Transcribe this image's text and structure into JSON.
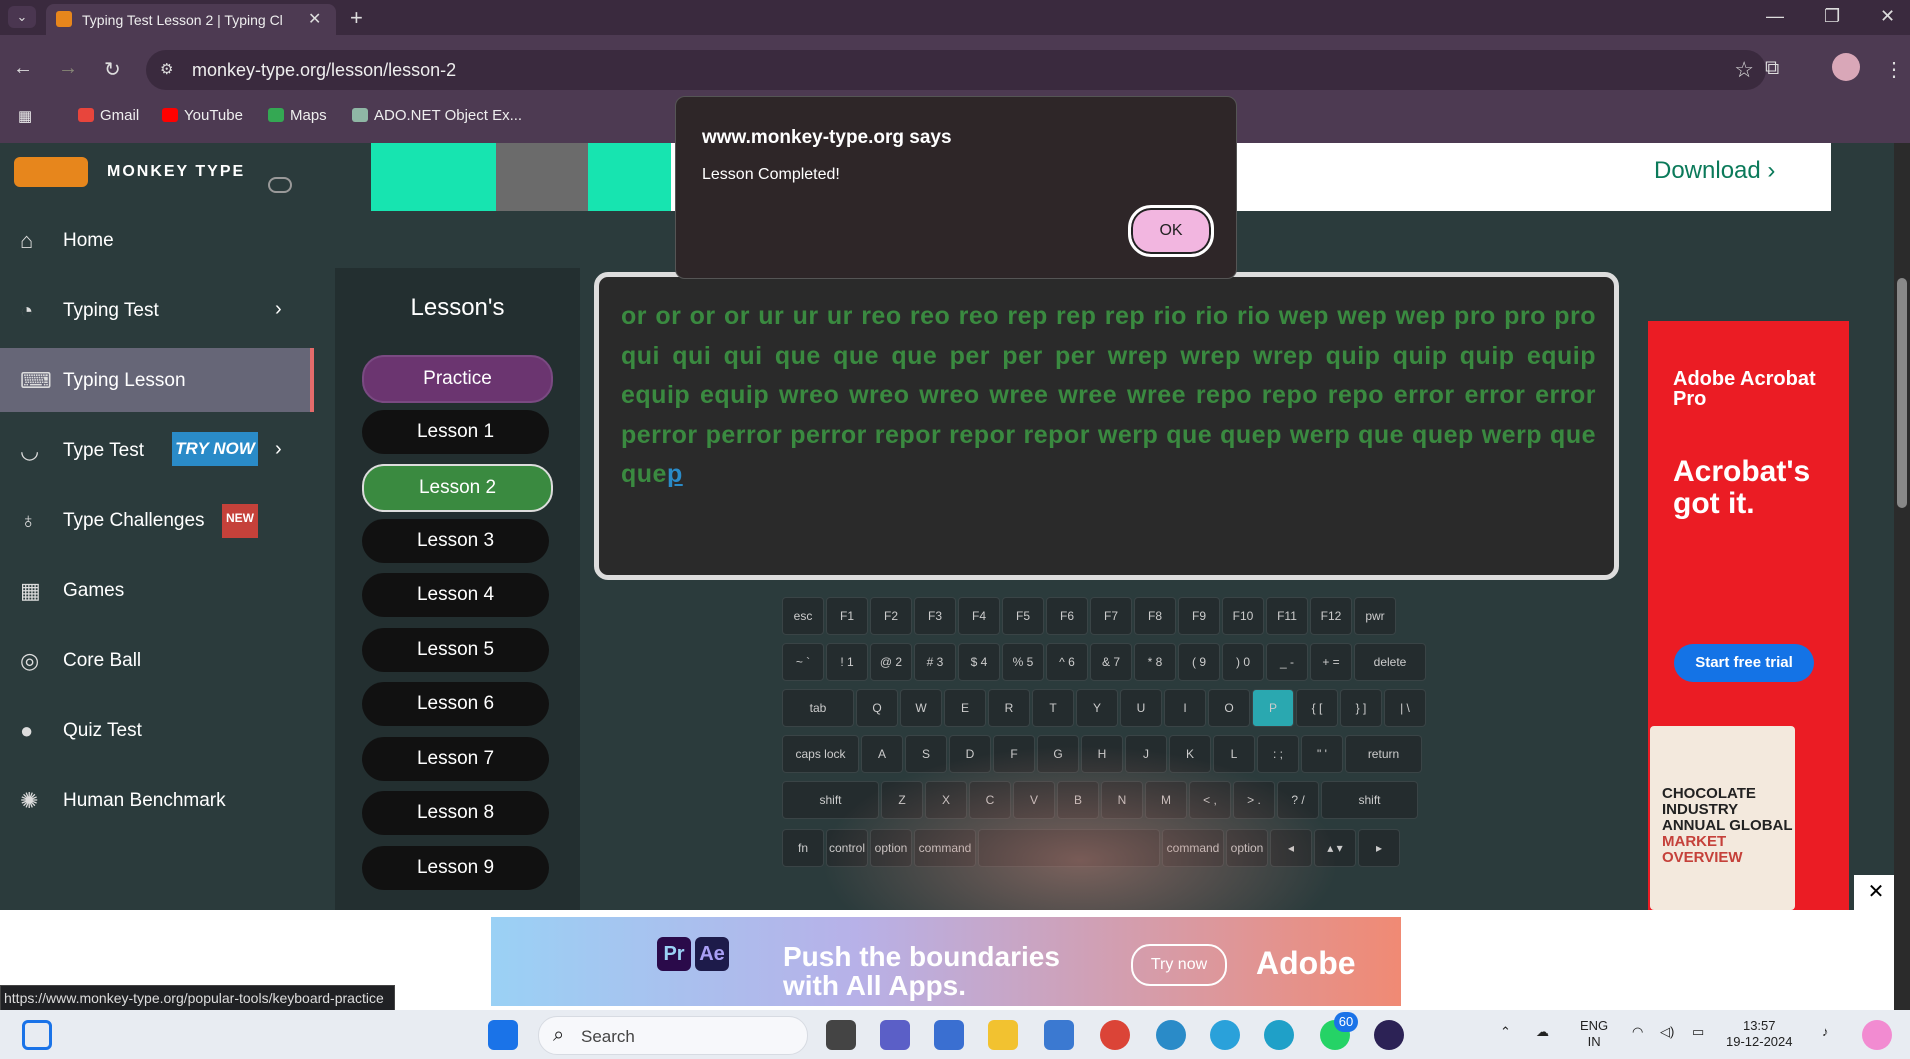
{
  "browser": {
    "tab_title": "Typing Test Lesson 2 | Typing Cl",
    "url": "monkey-type.org/lesson/lesson-2",
    "bookmarks": [
      {
        "label": "Gmail",
        "color": "#e8453c"
      },
      {
        "label": "YouTube",
        "color": "#ff0000"
      },
      {
        "label": "Maps",
        "color": "#34a853"
      },
      {
        "label": "ADO.NET Object Ex...",
        "color": "#8fb7a5"
      }
    ]
  },
  "sidebar": {
    "logo_text": "MONKEY TYPE",
    "items": [
      {
        "label": "Home",
        "icon": "home-icon",
        "glyph": "⌂"
      },
      {
        "label": "Typing Test",
        "icon": "typing-test-icon",
        "glyph": "◔",
        "arrow": "›"
      },
      {
        "label": "Typing Lesson",
        "icon": "keyboard-icon",
        "glyph": "⌨",
        "active": true
      },
      {
        "label": "Type Test",
        "icon": "type-test-icon",
        "glyph": "◡",
        "badge": "TRY NOW",
        "arrow": "›"
      },
      {
        "label": "Type Challenges",
        "icon": "challenge-icon",
        "glyph": "♁",
        "badge": "NEW"
      },
      {
        "label": "Games",
        "icon": "games-icon",
        "glyph": "▦"
      },
      {
        "label": "Core Ball",
        "icon": "core-ball-icon",
        "glyph": "◎"
      },
      {
        "label": "Quiz Test",
        "icon": "quiz-icon",
        "glyph": "●"
      },
      {
        "label": "Human Benchmark",
        "icon": "benchmark-icon",
        "glyph": "✺"
      }
    ]
  },
  "top_ad": {
    "cta": "Download ›"
  },
  "lessons": {
    "title": "Lesson's",
    "items": [
      "Practice",
      "Lesson 1",
      "Lesson 2",
      "Lesson 3",
      "Lesson 4",
      "Lesson 5",
      "Lesson 6",
      "Lesson 7",
      "Lesson 8",
      "Lesson 9"
    ],
    "selected": "Lesson 2"
  },
  "typing": {
    "typed": "or or or or ur ur ur reo reo reo rep rep rep rio rio rio wep wep wep pro pro pro qui qui qui que que que per per per wrep wrep wrep quip quip quip equip equip equip wreo wreo wreo wree wree wree repo repo repo error error error perror perror perror repor repor repor werp que quep werp que quep werp que que",
    "current": "p"
  },
  "keyboard": {
    "rows": [
      [
        "esc",
        "F1",
        "F2",
        "F3",
        "F4",
        "F5",
        "F6",
        "F7",
        "F8",
        "F9",
        "F10",
        "F11",
        "F12",
        "pwr"
      ],
      [
        "~ `",
        "! 1",
        "@ 2",
        "# 3",
        "$ 4",
        "% 5",
        "^ 6",
        "& 7",
        "* 8",
        "( 9",
        ") 0",
        "_ -",
        "+ =",
        "delete"
      ],
      [
        "tab",
        "Q",
        "W",
        "E",
        "R",
        "T",
        "Y",
        "U",
        "I",
        "O",
        "P",
        "{ [",
        "} ]",
        "| \\"
      ],
      [
        "caps lock",
        "A",
        "S",
        "D",
        "F",
        "G",
        "H",
        "J",
        "K",
        "L",
        ": ;",
        "\" '",
        "return"
      ],
      [
        "shift",
        "Z",
        "X",
        "C",
        "V",
        "B",
        "N",
        "M",
        "< ,",
        "> .",
        "? /",
        "shift"
      ],
      [
        "fn",
        "control",
        "option",
        "command",
        "",
        "command",
        "option",
        "◂",
        "▴ ▾",
        "▸"
      ]
    ],
    "highlighted": "P"
  },
  "right_ad": {
    "brand": "Adobe Acrobat Pro",
    "headline": "Acrobat's got it.",
    "cta": "Start free trial",
    "card_text": "CHOCOLATE INDUSTRY ANNUAL GLOBAL",
    "card_highlight": "MARKET OVERVIEW"
  },
  "bottom_ad": {
    "headline": "Push the boundaries with All Apps.",
    "cta": "Try now",
    "brand": "Adobe",
    "app1": "Pr",
    "app2": "Ae"
  },
  "status_url": "https://www.monkey-type.org/popular-tools/keyboard-practice",
  "dialog": {
    "title": "www.monkey-type.org says",
    "message": "Lesson Completed!",
    "ok": "OK"
  },
  "taskbar": {
    "search": "Search",
    "lang": "ENG",
    "region": "IN",
    "time": "13:57",
    "date": "19-12-2024",
    "whatsapp_badge": "60"
  }
}
